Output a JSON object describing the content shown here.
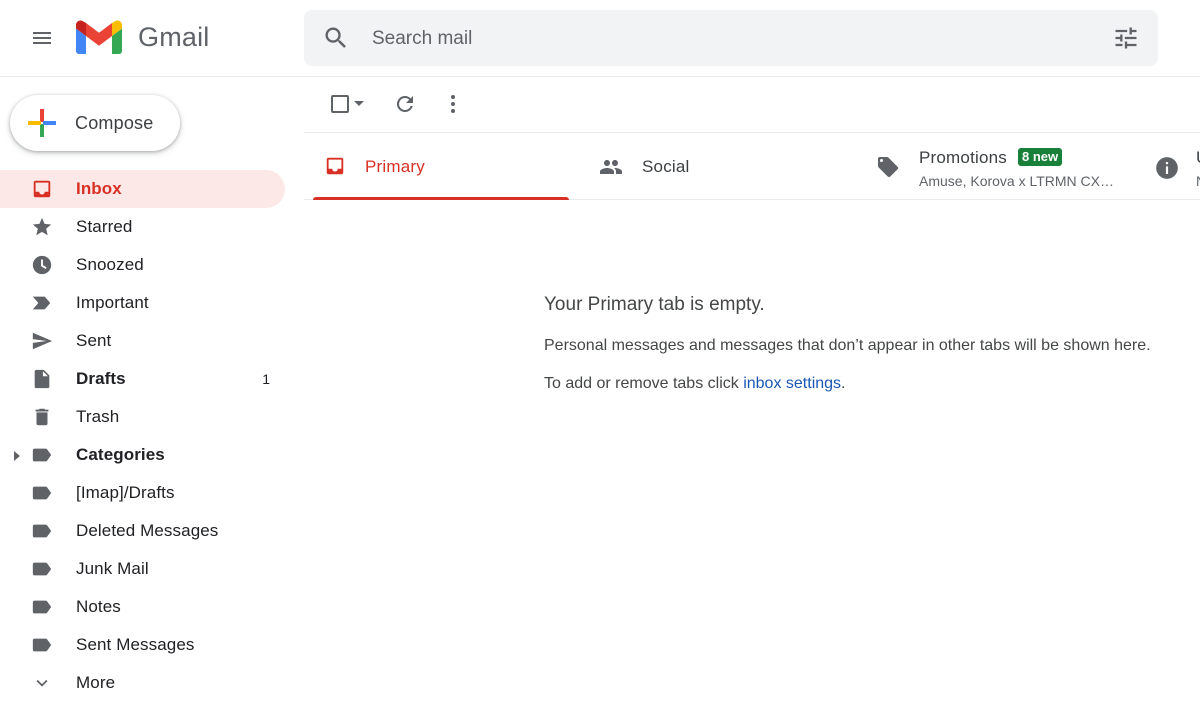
{
  "header": {
    "app_name": "Gmail",
    "search_placeholder": "Search mail",
    "icons": [
      "menu-icon",
      "gmail-logo",
      "search-icon",
      "tune-icon"
    ]
  },
  "compose": {
    "label": "Compose"
  },
  "sidebar": {
    "items": [
      {
        "label": "Inbox",
        "icon": "inbox-icon",
        "count": "",
        "active": true
      },
      {
        "label": "Starred",
        "icon": "star-icon",
        "count": ""
      },
      {
        "label": "Snoozed",
        "icon": "clock-icon",
        "count": ""
      },
      {
        "label": "Important",
        "icon": "important-icon",
        "count": ""
      },
      {
        "label": "Sent",
        "icon": "send-icon",
        "count": ""
      },
      {
        "label": "Drafts",
        "icon": "draft-icon",
        "count": "1",
        "bold": true
      },
      {
        "label": "Trash",
        "icon": "trash-icon",
        "count": ""
      },
      {
        "label": "Categories",
        "icon": "label-icon",
        "count": "",
        "bold": true
      },
      {
        "label": "[Imap]/Drafts",
        "icon": "label-icon",
        "count": ""
      },
      {
        "label": "Deleted Messages",
        "icon": "label-icon",
        "count": ""
      },
      {
        "label": "Junk Mail",
        "icon": "label-icon",
        "count": ""
      },
      {
        "label": "Notes",
        "icon": "label-icon",
        "count": ""
      },
      {
        "label": "Sent Messages",
        "icon": "label-icon",
        "count": ""
      },
      {
        "label": "More",
        "icon": "chevron-down-icon",
        "count": ""
      }
    ]
  },
  "toolbar": {
    "icons": [
      "checkbox-icon",
      "caret-down-icon",
      "refresh-icon",
      "more-vert-icon"
    ]
  },
  "tabs": {
    "primary": {
      "label": "Primary"
    },
    "social": {
      "label": "Social"
    },
    "promotions": {
      "label": "Promotions",
      "badge": "8 new",
      "subtitle": "Amuse, Korova x LTRMN CX…"
    },
    "updates": {
      "label": "U",
      "subtitle": "N"
    }
  },
  "empty_state": {
    "title": "Your Primary tab is empty.",
    "message": "Personal messages and messages that don’t appear in other tabs will be shown here.",
    "hint_prefix": "To add or remove tabs click ",
    "hint_link": "inbox settings",
    "hint_suffix": "."
  },
  "colors": {
    "accent_red": "#d93025",
    "active_bg": "#fce8e6",
    "badge_green": "#188038",
    "link_blue": "#1a57b5",
    "search_bg": "#f1f3f4",
    "icon_gray": "#5f6368"
  }
}
